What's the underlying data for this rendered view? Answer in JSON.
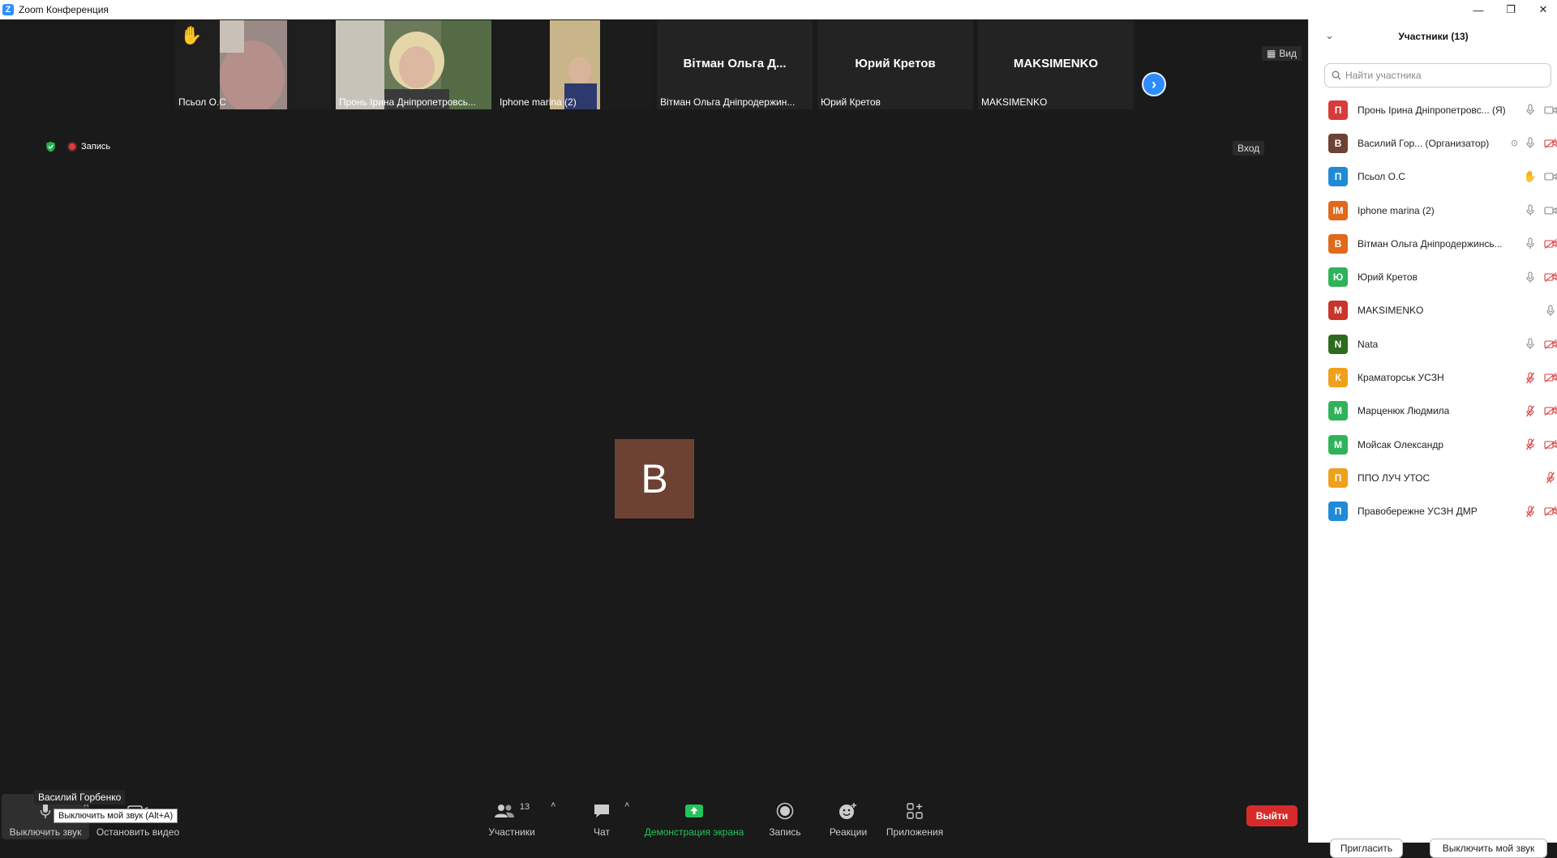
{
  "window": {
    "title": "Zoom Конференция",
    "logo_letter": "Z"
  },
  "thumbnails": [
    {
      "name": "Псьол О.С",
      "center_name": "",
      "hand": "✋"
    },
    {
      "name": "Пронь Ірина Дніпропетровсь...",
      "center_name": ""
    },
    {
      "name": "Iphone marina (2)",
      "center_name": ""
    },
    {
      "name": "Вітман Ольга Дніпродержин...",
      "center_name": "Вітман Ольга Д..."
    },
    {
      "name": "Юрий Кретов",
      "center_name": "Юрий Кретов"
    },
    {
      "name": "MAKSIMENKO",
      "center_name": "MAKSIMENKO"
    }
  ],
  "view_label": "Вид",
  "recording_label": "Запись",
  "enter_label": "Вход",
  "main_avatar_letter": "B",
  "speaker_name_tag": "Василий Горбенко",
  "tooltip": "Выключить мой звук (Alt+A)",
  "toolbar": {
    "mute": "Выключить звук",
    "video": "Остановить видео",
    "participants": "Участники",
    "participants_count": "13",
    "chat": "Чат",
    "share": "Демонстрация экрана",
    "record": "Запись",
    "reactions": "Реакции",
    "apps": "Приложения",
    "leave": "Выйти"
  },
  "panel": {
    "title": "Участники (13)",
    "search_placeholder": "Найти участника",
    "invite": "Пригласить",
    "mute_me": "Выключить мой звук",
    "participants": [
      {
        "initial": "П",
        "name": "Пронь Ірина Дніпропетровс... (Я)",
        "color": "#d83b3b",
        "mic": "on",
        "cam": "on"
      },
      {
        "initial": "B",
        "name": "Василий Гор... (Организатор)",
        "color": "#6e4233",
        "mic": "on",
        "cam": "off",
        "extra": "⊙"
      },
      {
        "initial": "П",
        "name": "Псьол О.С",
        "color": "#1f8ad8",
        "mic": "hand",
        "cam": "on"
      },
      {
        "initial": "IM",
        "name": "Iphone marina (2)",
        "color": "#e0691b",
        "mic": "on",
        "cam": "on"
      },
      {
        "initial": "В",
        "name": "Вітман Ольга Дніпродержинсь...",
        "color": "#e0691b",
        "mic": "on",
        "cam": "off"
      },
      {
        "initial": "Ю",
        "name": "Юрий Кретов",
        "color": "#2fb35a",
        "mic": "on",
        "cam": "off"
      },
      {
        "initial": "M",
        "name": "MAKSIMENKO",
        "color": "#c9342b",
        "mic": "none",
        "cam": "mic"
      },
      {
        "initial": "N",
        "name": "Nata",
        "color": "#2e6b1e",
        "mic": "on",
        "cam": "off"
      },
      {
        "initial": "К",
        "name": "Краматорськ УСЗН",
        "color": "#f0a01a",
        "mic": "off",
        "cam": "off"
      },
      {
        "initial": "М",
        "name": "Марценюк Людмила",
        "color": "#2fb35a",
        "mic": "off",
        "cam": "off"
      },
      {
        "initial": "М",
        "name": "Мойсак Олександр",
        "color": "#2fb35a",
        "mic": "off",
        "cam": "off"
      },
      {
        "initial": "П",
        "name": "ППО ЛУЧ УТОС",
        "color": "#f0a01a",
        "mic": "none",
        "cam": "micoff"
      },
      {
        "initial": "П",
        "name": "Правобережне УСЗН ДМР",
        "color": "#1f8ad8",
        "mic": "off",
        "cam": "off"
      }
    ]
  }
}
